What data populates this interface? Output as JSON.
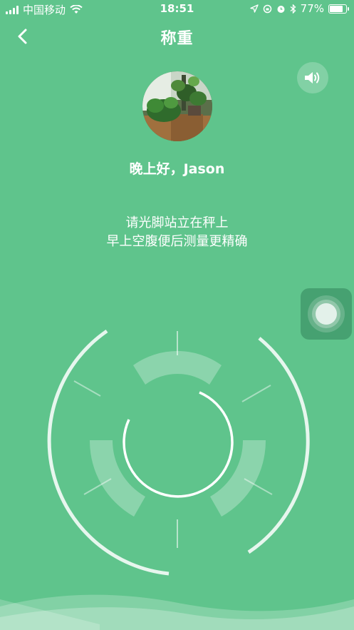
{
  "status_bar": {
    "carrier": "中国移动",
    "time": "18:51",
    "battery_percent": "77%",
    "battery_level": 0.77,
    "icons": [
      "signal-icon",
      "wifi-icon",
      "location-icon",
      "rotation-lock-icon",
      "alarm-icon",
      "bluetooth-icon",
      "battery-icon"
    ]
  },
  "nav": {
    "back_icon": "chevron-left-icon",
    "title": "称重"
  },
  "sound_button": {
    "icon": "speaker-icon"
  },
  "greeting": "晚上好，Jason",
  "instructions": {
    "line1": "请光脚站立在秤上",
    "line2": "早上空腹便后测量更精确"
  },
  "colors": {
    "background": "#5fc48c",
    "foreground": "#ffffff"
  }
}
